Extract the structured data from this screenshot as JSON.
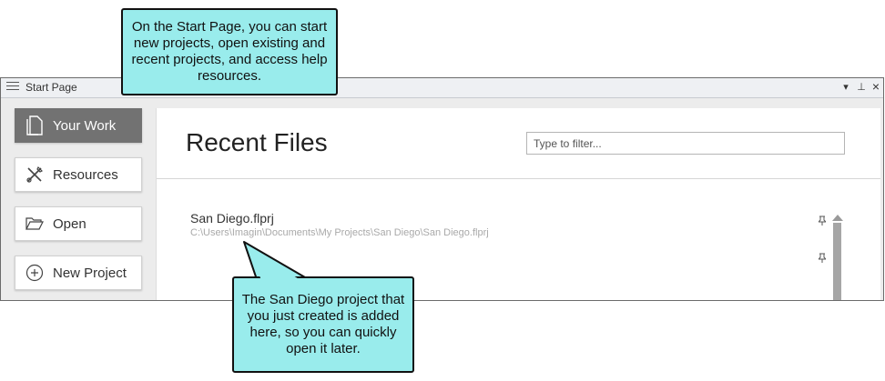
{
  "window": {
    "title": "Start Page",
    "controls": {
      "dropdown": "▾",
      "pin": "⊥",
      "close": "×"
    }
  },
  "sidebar": {
    "items": [
      {
        "label": "Your Work",
        "icon": "document-icon",
        "active": true
      },
      {
        "label": "Resources",
        "icon": "tools-icon",
        "active": false
      },
      {
        "label": "Open",
        "icon": "folder-icon",
        "active": false
      },
      {
        "label": "New Project",
        "icon": "plus-circle-icon",
        "active": false
      }
    ]
  },
  "main": {
    "heading": "Recent Files",
    "filter_placeholder": "Type to filter...",
    "recent_files": [
      {
        "name": "San Diego.flprj",
        "path": "C:\\Users\\Imagin\\Documents\\My Projects\\San Diego\\San Diego.flprj"
      }
    ]
  },
  "callouts": {
    "top": "On the Start Page, you can start new projects, open existing and recent projects, and access help resources.",
    "bottom": "The San Diego project that you just created is added here, so you can quickly open it later."
  },
  "colors": {
    "callout_bg": "#99ECEC",
    "active_nav": "#727272"
  }
}
